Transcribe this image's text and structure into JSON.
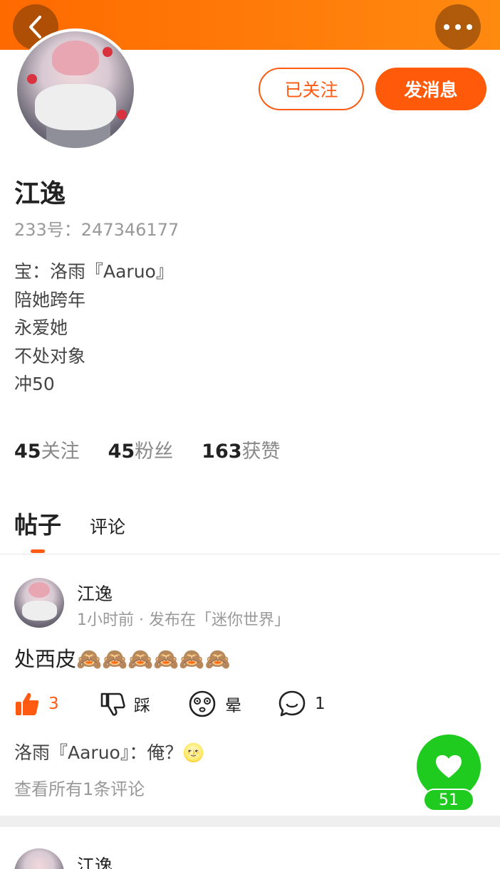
{
  "header": {
    "back_icon": "chevron-left-icon",
    "more_icon": "more-dots-icon"
  },
  "profile": {
    "name": "江逸",
    "uid": "233号：247346177",
    "bio": [
      "宝：洛雨『Aaruo』",
      "陪她跨年",
      "永爱她",
      "不处对象",
      "冲50"
    ],
    "follow_label": "已关注",
    "message_label": "发消息"
  },
  "stats": {
    "following_count": "45",
    "following_label": "关注",
    "fans_count": "45",
    "fans_label": "粉丝",
    "likes_count": "163",
    "likes_label": "获赞"
  },
  "tabs": {
    "posts": "帖子",
    "comments": "评论"
  },
  "post": {
    "author": "江逸",
    "meta": "1小时前 · 发布在「迷你世界」",
    "text": "处西皮🙈🙈🙈🙈🙈🙈",
    "like_count": "3",
    "dislike_label": "踩",
    "dizzy_label": "晕",
    "comment_count": "1",
    "comment_preview": "洛雨『Aaruo』：俺？🌝",
    "view_all": "查看所有1条评论"
  },
  "fab": {
    "icon": "heart-icon",
    "count": "51",
    "color": "#1ecb1e"
  },
  "post2": {
    "author": "江逸"
  },
  "colors": {
    "accent": "#ff5a12",
    "header_gradient_start": "#ff6a00",
    "header_gradient_end": "#ff8a10"
  }
}
